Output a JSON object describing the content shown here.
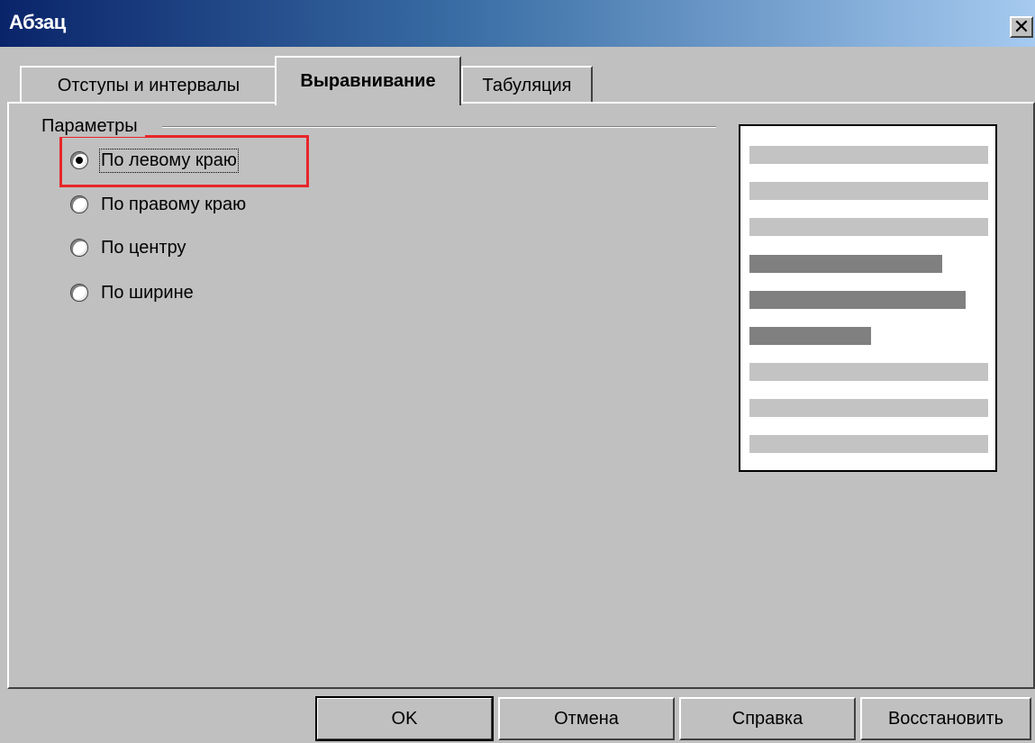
{
  "window": {
    "title": "Абзац",
    "close_glyph": "✕"
  },
  "tabs": [
    {
      "label": "Отступы и интервалы",
      "active": false
    },
    {
      "label": "Выравнивание",
      "active": true
    },
    {
      "label": "Табуляция",
      "active": false
    }
  ],
  "options": {
    "group_label": "Параметры",
    "radios": [
      {
        "label": "По левому краю",
        "checked": true
      },
      {
        "label": "По правому краю",
        "checked": false
      },
      {
        "label": "По центру",
        "checked": false
      },
      {
        "label": "По ширине",
        "checked": false
      }
    ]
  },
  "buttons": {
    "ok": "OK",
    "cancel": "Отмена",
    "help": "Справка",
    "reset": "Восстановить"
  },
  "colors": {
    "highlight": "#e8262a",
    "dialog_bg": "#c0c0c0"
  }
}
